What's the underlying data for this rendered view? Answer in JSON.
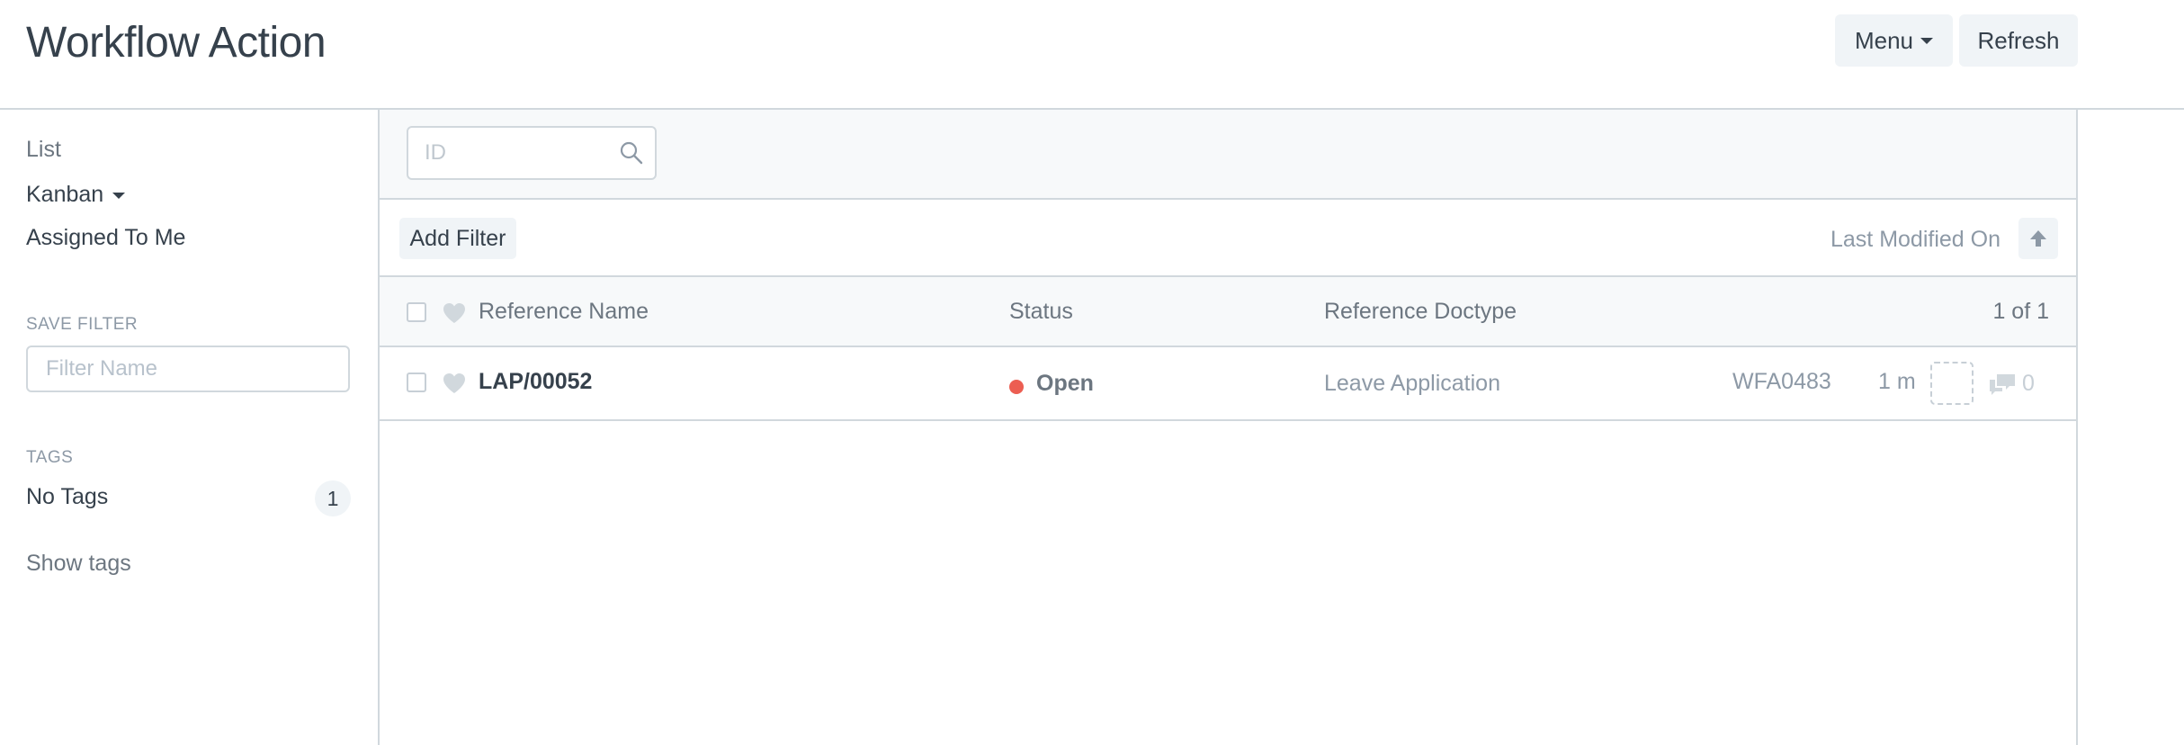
{
  "header": {
    "title": "Workflow Action",
    "menu_label": "Menu",
    "refresh_label": "Refresh"
  },
  "sidebar": {
    "views": [
      {
        "label": "List"
      },
      {
        "label": "Kanban"
      },
      {
        "label": "Assigned To Me"
      }
    ],
    "save_filter_label": "SAVE FILTER",
    "filter_name_placeholder": "Filter Name",
    "tags_label": "TAGS",
    "no_tags_label": "No Tags",
    "no_tags_count": "1",
    "show_tags_label": "Show tags"
  },
  "search": {
    "placeholder": "ID"
  },
  "filters": {
    "add_filter_label": "Add Filter",
    "sort_label": "Last Modified On"
  },
  "list": {
    "columns": {
      "reference_name": "Reference Name",
      "status": "Status",
      "reference_doctype": "Reference Doctype",
      "count": "1 of 1"
    },
    "rows": [
      {
        "reference_name": "LAP/00052",
        "status": "Open",
        "status_color": "#ec5e52",
        "reference_doctype": "Leave Application",
        "id": "WFA0483",
        "modified": "1 m",
        "comments": "0"
      }
    ]
  },
  "colors": {
    "accent_bg": "#f0f4f7",
    "border": "#d1d8dd",
    "text": "#36414c",
    "muted": "#8d99a6"
  },
  "icons": [
    "search-icon",
    "heart-icon",
    "sort-ascending-icon",
    "comment-icon",
    "caret-down-icon"
  ]
}
